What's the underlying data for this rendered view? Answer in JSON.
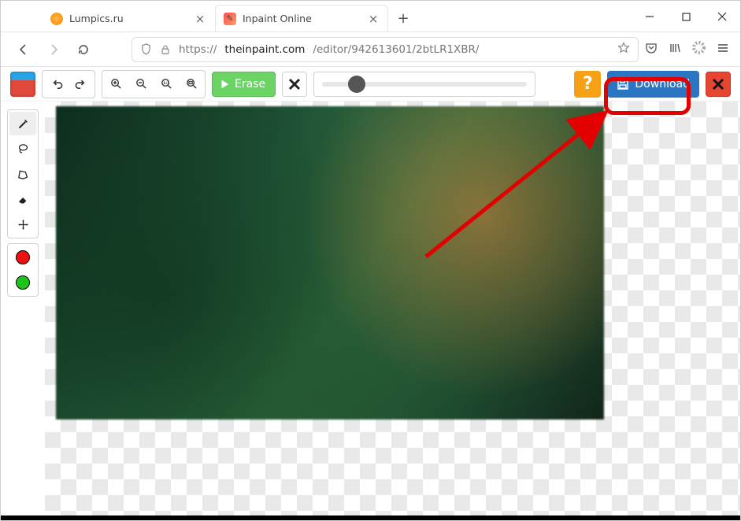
{
  "tabs": [
    {
      "title": "Lumpics.ru",
      "active": false
    },
    {
      "title": "Inpaint Online",
      "active": true
    }
  ],
  "url": {
    "protocol": "https://",
    "domain": "theinpaint.com",
    "path": "/editor/942613601/2btLR1XBR/"
  },
  "toolbar": {
    "erase_label": "Erase",
    "download_label": "Download",
    "help_glyph": "?"
  },
  "icons": {
    "undo": "undo-icon",
    "redo": "redo-icon",
    "zoom_in": "zoom-in-icon",
    "zoom_out": "zoom-out-icon",
    "zoom_actual": "zoom-1to1-icon",
    "zoom_fit": "zoom-fit-icon",
    "cancel": "x-icon",
    "close_app": "x-icon",
    "save": "floppy-icon",
    "marker": "marker-icon",
    "lasso": "lasso-icon",
    "polygon": "polygon-icon",
    "eraser": "eraser-icon",
    "move": "move-icon"
  }
}
